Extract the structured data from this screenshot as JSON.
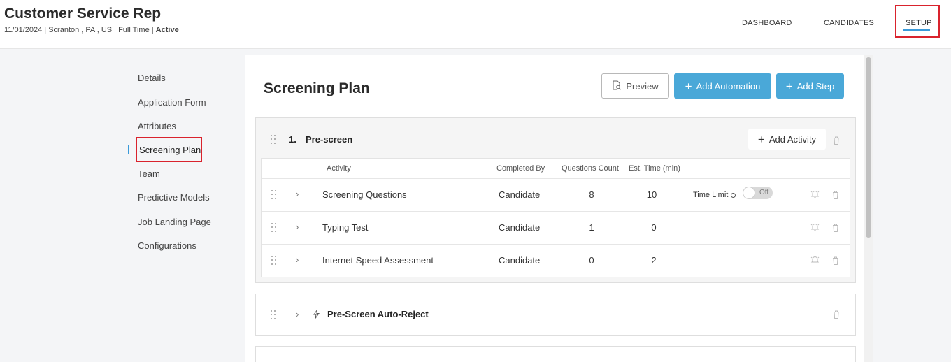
{
  "header": {
    "job_title": "Customer Service Rep",
    "meta_text": "11/01/2024 | Scranton , PA , US | Full Time | ",
    "status": "Active",
    "nav": {
      "dashboard": "DASHBOARD",
      "candidates": "CANDIDATES",
      "setup": "SETUP"
    }
  },
  "sidebar": {
    "items": [
      {
        "label": "Details"
      },
      {
        "label": "Application Form"
      },
      {
        "label": "Attributes"
      },
      {
        "label": "Screening Plan",
        "active": true
      },
      {
        "label": "Team"
      },
      {
        "label": "Predictive Models"
      },
      {
        "label": "Job Landing Page"
      },
      {
        "label": "Configurations"
      }
    ]
  },
  "main": {
    "title": "Screening Plan",
    "buttons": {
      "preview": "Preview",
      "add_automation": "Add Automation",
      "add_step": "Add Step"
    },
    "steps": [
      {
        "number": "1.",
        "name": "Pre-screen",
        "add_activity": "Add Activity",
        "columns": {
          "activity": "Activity",
          "completed_by": "Completed By",
          "questions_count": "Questions Count",
          "est_time": "Est. Time (min)"
        },
        "rows": [
          {
            "activity": "Screening Questions",
            "completed_by": "Candidate",
            "questions": "8",
            "time": "10",
            "time_limit_label": "Time Limit",
            "toggle": "Off"
          },
          {
            "activity": "Typing Test",
            "completed_by": "Candidate",
            "questions": "1",
            "time": "0"
          },
          {
            "activity": "Internet Speed Assessment",
            "completed_by": "Candidate",
            "questions": "0",
            "time": "2"
          }
        ]
      }
    ],
    "automation": {
      "name": "Pre-Screen Auto-Reject"
    }
  },
  "colors": {
    "accent": "#4aa8d8",
    "highlight_box": "#d9232d"
  }
}
